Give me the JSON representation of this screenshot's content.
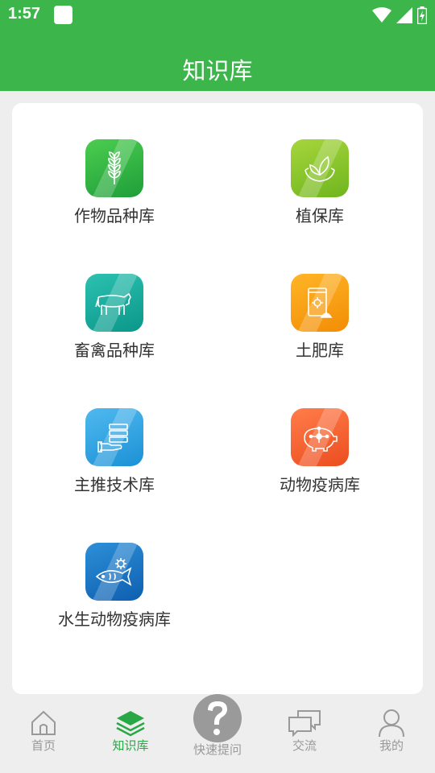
{
  "status_bar": {
    "time": "1:57"
  },
  "header": {
    "title": "知识库"
  },
  "tiles": [
    {
      "label": "作物品种库",
      "icon": "wheat-icon",
      "color_top": "#4ccd4f",
      "color_bottom": "#1e9e3a"
    },
    {
      "label": "植保库",
      "icon": "leaf-hands-icon",
      "color_top": "#a6d63b",
      "color_bottom": "#6fb51e"
    },
    {
      "label": "畜禽品种库",
      "icon": "cow-icon",
      "color_top": "#2cc1b0",
      "color_bottom": "#0a978a"
    },
    {
      "label": "土肥库",
      "icon": "fertilizer-bag-icon",
      "color_top": "#ffb526",
      "color_bottom": "#f28d06"
    },
    {
      "label": "主推技术库",
      "icon": "tech-hand-icon",
      "color_top": "#4fb9ef",
      "color_bottom": "#1c91d6"
    },
    {
      "label": "动物疫病库",
      "icon": "pig-virus-icon",
      "color_top": "#ff7d4a",
      "color_bottom": "#ec4d1f"
    },
    {
      "label": "水生动物疫病库",
      "icon": "fish-virus-icon",
      "color_top": "#2d8fd8",
      "color_bottom": "#0e5fb0"
    }
  ],
  "bottom_nav": {
    "items": [
      {
        "label": "首页",
        "icon": "home-icon",
        "active": false
      },
      {
        "label": "知识库",
        "icon": "layers-icon",
        "active": true
      },
      {
        "label": "交流",
        "icon": "chat-icon",
        "active": false
      },
      {
        "label": "我的",
        "icon": "user-icon",
        "active": false
      }
    ],
    "fab": {
      "label": "快速提问",
      "icon": "question-icon"
    }
  },
  "colors": {
    "brand_green": "#3cb64a",
    "active_nav": "#28a745",
    "inactive_nav": "#999999"
  }
}
